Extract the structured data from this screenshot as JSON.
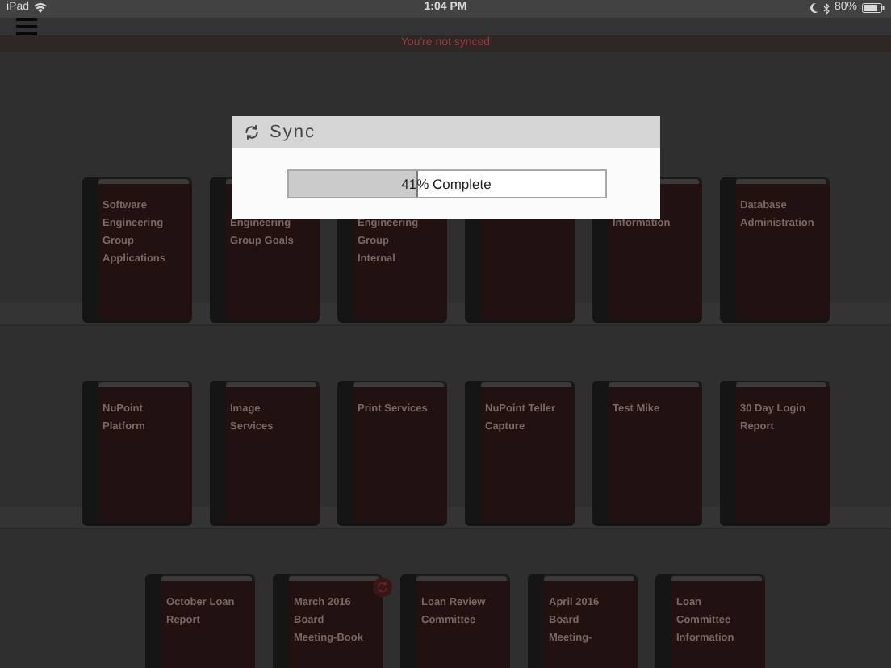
{
  "status_bar": {
    "device": "iPad",
    "time": "1:04 PM",
    "battery": "80%"
  },
  "banner": "You're not synced",
  "shelves": [
    {
      "books": [
        {
          "kind": "book",
          "lines": [
            "Software",
            "Engineering",
            "Group",
            "Applications"
          ],
          "covered": false,
          "syncing": false
        },
        {
          "kind": "book",
          "lines": [
            "Engineering",
            "Group Goals"
          ],
          "covered": true,
          "syncing": false
        },
        {
          "kind": "book",
          "lines": [
            "Engineering",
            "Group",
            "Internal"
          ],
          "covered": true,
          "syncing": false
        },
        {
          "kind": "book"
        },
        {
          "kind": "book",
          "lines": [
            "Information"
          ],
          "covered": true,
          "syncing": false
        },
        {
          "kind": "book",
          "lines": [
            "Database",
            "Administration"
          ],
          "covered": false,
          "syncing": false
        }
      ]
    },
    {
      "books": [
        {
          "kind": "book",
          "lines": [
            "NuPoint",
            "Platform"
          ],
          "covered": false,
          "syncing": false
        },
        {
          "kind": "book",
          "lines": [
            "Image",
            "Services"
          ],
          "covered": false,
          "syncing": false
        },
        {
          "kind": "book",
          "lines": [
            "Print Services"
          ],
          "covered": false,
          "syncing": false
        },
        {
          "kind": "book",
          "lines": [
            "NuPoint Teller",
            "Capture"
          ],
          "covered": false,
          "syncing": false
        },
        {
          "kind": "book",
          "lines": [
            "Test Mike"
          ],
          "covered": false,
          "syncing": false
        },
        {
          "kind": "book",
          "lines": [
            "30 Day Login",
            "Report"
          ],
          "covered": false,
          "syncing": false
        }
      ]
    },
    {
      "books": [
        {
          "kind": "book",
          "lines": [
            "October Loan",
            "Report"
          ],
          "covered": false,
          "syncing": false
        },
        {
          "kind": "book",
          "lines": [
            "March 2016",
            "Board",
            "Meeting-Book"
          ],
          "covered": false,
          "syncing": true
        },
        {
          "kind": "book",
          "lines": [
            "Loan Review",
            "Committee"
          ],
          "covered": false,
          "syncing": false
        },
        {
          "kind": "book",
          "lines": [
            "April 2016",
            "Board",
            "Meeting-"
          ],
          "covered": false,
          "syncing": false
        },
        {
          "kind": "book",
          "lines": [
            "Loan",
            "Committee",
            "Information"
          ],
          "covered": false,
          "syncing": false
        }
      ]
    }
  ],
  "dialog": {
    "title": "Sync",
    "progress": {
      "level": 0.41,
      "label": "41% Complete"
    }
  }
}
